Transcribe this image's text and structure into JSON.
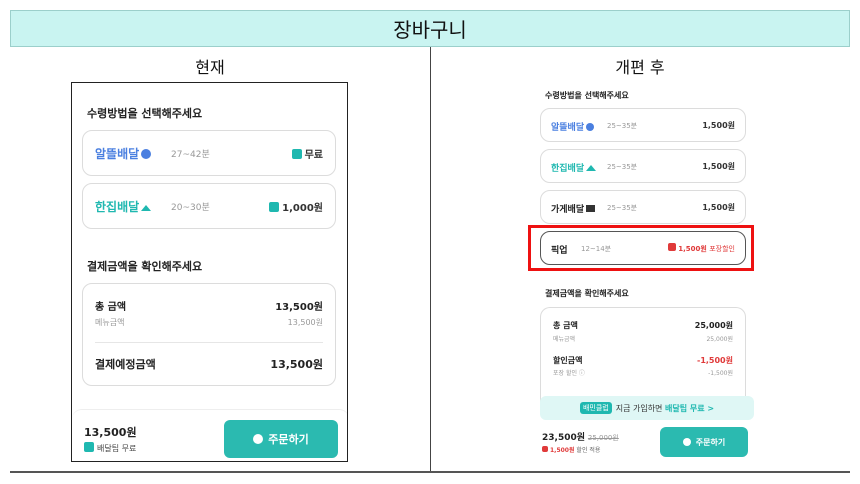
{
  "page_title": "장바구니",
  "current": {
    "heading": "현재",
    "delivery_section_label": "수령방법을 선택해주세요",
    "options": [
      {
        "name": "알뜰배달",
        "time": "27~42분",
        "price": "무료"
      },
      {
        "name": "한집배달",
        "time": "20~30분",
        "price": "1,000원"
      }
    ],
    "payment_section_label": "결제금액을 확인해주세요",
    "total_label": "총 금액",
    "total_value": "13,500원",
    "menu_label": "메뉴금액",
    "menu_value": "13,500원",
    "expected_label": "결제예정금액",
    "expected_value": "13,500원",
    "footer_total": "13,500원",
    "footer_note": "배달팁 무료",
    "order_button": "주문하기"
  },
  "revised": {
    "heading": "개편 후",
    "delivery_section_label": "수령방법을 선택해주세요",
    "options": [
      {
        "name": "알뜰배달",
        "time": "25~35분",
        "price": "1,500원"
      },
      {
        "name": "한집배달",
        "time": "25~35분",
        "price": "1,500원"
      },
      {
        "name": "가게배달",
        "time": "25~35분",
        "price": "1,500원"
      },
      {
        "name": "픽업",
        "time": "12~14분",
        "price": "1,500원",
        "price_note": "포장할인"
      }
    ],
    "payment_section_label": "결제금액을 확인해주세요",
    "total_label": "총 금액",
    "total_value": "25,000원",
    "menu_label": "메뉴금액",
    "menu_value": "25,000원",
    "discount_label": "할인금액",
    "discount_value": "-1,500원",
    "pack_discount_label": "포장 할인 ⓘ",
    "pack_discount_value": "-1,500원",
    "promo_tag": "배민클럽",
    "promo_text": "지금 가입하면",
    "promo_link": "배달팁 무료 >",
    "footer_total": "23,500원",
    "footer_original": "25,000원",
    "footer_discount": "1,500원",
    "footer_discount_note": "할인 적용",
    "order_button": "주문하기"
  },
  "colors": {
    "accent": "#2bbab0",
    "highlight": "#ee1111",
    "discount": "#e03a3a",
    "title_bg": "#c9f4f1"
  }
}
